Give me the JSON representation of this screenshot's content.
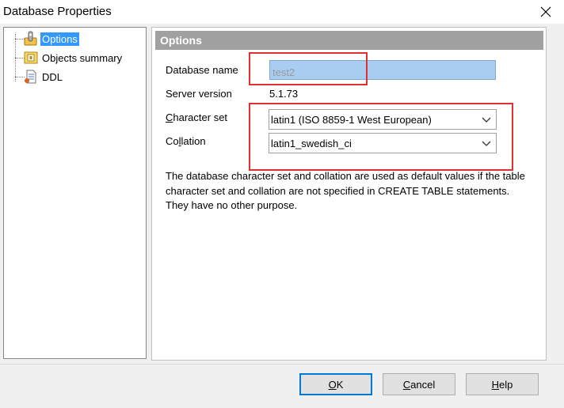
{
  "window": {
    "title": "Database Properties"
  },
  "tree": {
    "items": [
      {
        "label": "Options",
        "icon": "options-icon",
        "selected": true
      },
      {
        "label": "Objects summary",
        "icon": "objects-summary-icon",
        "selected": false
      },
      {
        "label": "DDL",
        "icon": "ddl-document-icon",
        "selected": false
      }
    ]
  },
  "options": {
    "header": "Options",
    "database_name": {
      "label": "Database name",
      "value": "test2"
    },
    "server_version": {
      "label": "Server version",
      "value": "5.1.73"
    },
    "character_set": {
      "label_accel": "C",
      "label_rest": "haracter set",
      "value": "latin1 (ISO 8859-1 West European)"
    },
    "collation": {
      "label_pre": "Co",
      "label_accel": "l",
      "label_rest": "lation",
      "value": "latin1_swedish_ci"
    },
    "info": "The database character set and collation are used as default values if the table character set and collation are not specified in CREATE TABLE statements. They have no other purpose."
  },
  "buttons": {
    "ok": {
      "accel": "O",
      "rest": "K"
    },
    "cancel": {
      "accel": "C",
      "rest": "ancel"
    },
    "help": {
      "accel": "H",
      "rest": "elp"
    }
  },
  "colors": {
    "selection": "#3399ff",
    "header_bg": "#a0a0a0",
    "input_highlight": "#a9cdf0",
    "annotation_red": "#e03030",
    "default_button_border": "#0078d7"
  }
}
